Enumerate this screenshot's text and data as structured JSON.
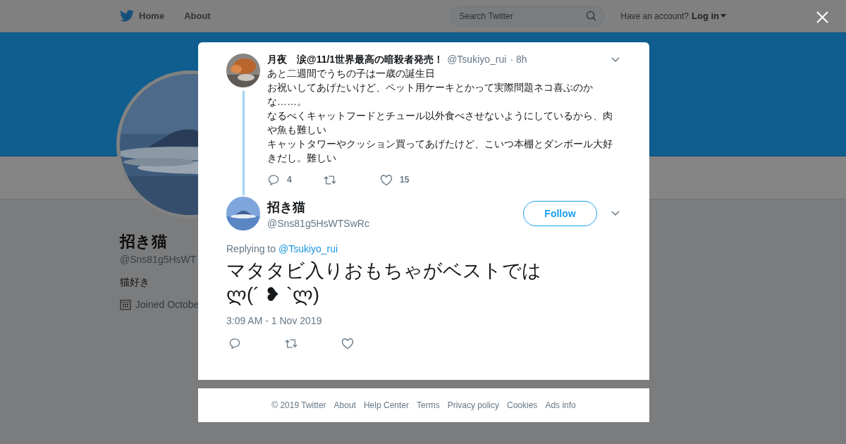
{
  "nav": {
    "home": "Home",
    "about": "About",
    "search": {
      "placeholder": "Search Twitter"
    },
    "have_account": "Have an account?",
    "login": "Log in"
  },
  "profile": {
    "name": "招き猫",
    "handle": "@Sns81g5HsWT",
    "bio": "猫好き",
    "joined": "Joined Octobe"
  },
  "parent_tweet": {
    "name": "月夜　涙@11/1世界最高の暗殺者発売！",
    "handle": "@Tsukiyo_rui",
    "time": "· 8h",
    "lines": [
      "あと二週間でうちの子は一歳の誕生日",
      "お祝いしてあげたいけど、ペット用ケーキとかって実際問題ネコ喜ぶのかな……。",
      "なるべくキャットフードとチュール以外食べさせないようにしているから、肉や魚も難しい",
      "キャットタワーやクッション買ってあげたけど、こいつ本棚とダンボール大好きだし。難しい"
    ],
    "replies": "4",
    "likes": "15"
  },
  "tweet": {
    "name": "招き猫",
    "handle": "@Sns81g5HsWTSwRc",
    "follow": "Follow",
    "replying_to": "Replying to",
    "reply_handle": "@Tsukiyo_rui",
    "lines": [
      "マタタビ入りおもちゃがベストでは",
      "ლ(´ ❥ `ლ)"
    ],
    "timestamp": "3:09 AM - 1 Nov 2019"
  },
  "footer": [
    "© 2019 Twitter",
    "About",
    "Help Center",
    "Terms",
    "Privacy policy",
    "Cookies",
    "Ads info"
  ]
}
